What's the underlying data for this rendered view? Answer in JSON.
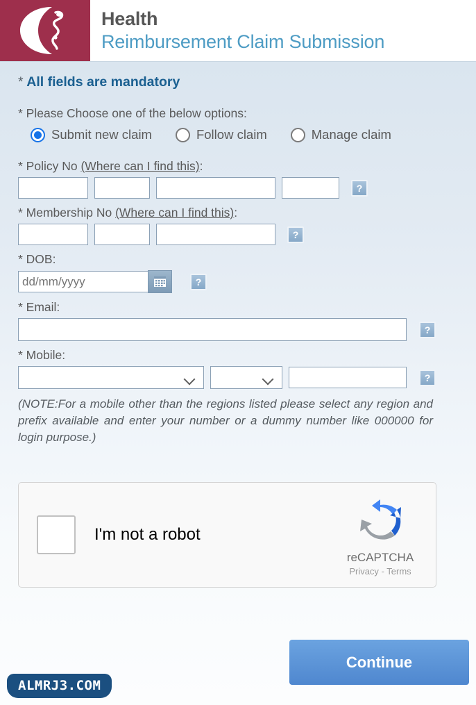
{
  "header": {
    "logo_icon": "crescent-caduceus-logo",
    "title_main": "Health",
    "title_sub": "Reimbursement Claim Submission",
    "logo_bg": "#9e2f4c",
    "title_sub_color": "#4e9cc4"
  },
  "form": {
    "mandatory_star": "*",
    "mandatory_text": "All fields are mandatory",
    "choose_label": "* Please Choose one of the below options:",
    "radio_options": [
      {
        "label": "Submit new claim",
        "selected": true
      },
      {
        "label": "Follow claim",
        "selected": false
      },
      {
        "label": "Manage claim",
        "selected": false
      }
    ],
    "policy": {
      "label_prefix": "* Policy No ",
      "label_link": "(Where can I find this)",
      "label_suffix": ":",
      "fields": [
        "",
        "",
        "",
        ""
      ],
      "help_icon": "question-mark-icon"
    },
    "membership": {
      "label_prefix": "* Membership No ",
      "label_link": "(Where can I find this)",
      "label_suffix": ":",
      "fields": [
        "",
        "",
        ""
      ],
      "help_icon": "question-mark-icon"
    },
    "dob": {
      "label": "* DOB:",
      "placeholder": "dd/mm/yyyy",
      "value": "",
      "calendar_icon": "calendar-icon",
      "help_icon": "question-mark-icon"
    },
    "email": {
      "label": "* Email:",
      "value": "",
      "help_icon": "question-mark-icon"
    },
    "mobile": {
      "label": "* Mobile:",
      "region_value": "",
      "prefix_value": "",
      "number_value": "",
      "dropdown_icon": "chevron-down-icon",
      "help_icon": "question-mark-icon"
    },
    "note": "(NOTE:For a mobile other than the regions listed please select any region and prefix available and enter your number or a dummy number like 000000 for login purpose.)"
  },
  "recaptcha": {
    "checkbox_checked": false,
    "label": "I'm not a robot",
    "logo_icon": "recaptcha-logo",
    "brand": "reCAPTCHA",
    "privacy": "Privacy",
    "separator": "-",
    "terms": "Terms"
  },
  "footer": {
    "continue_label": "Continue",
    "watermark": "ALMRJ3.COM",
    "continue_color": "#5a92d6"
  }
}
